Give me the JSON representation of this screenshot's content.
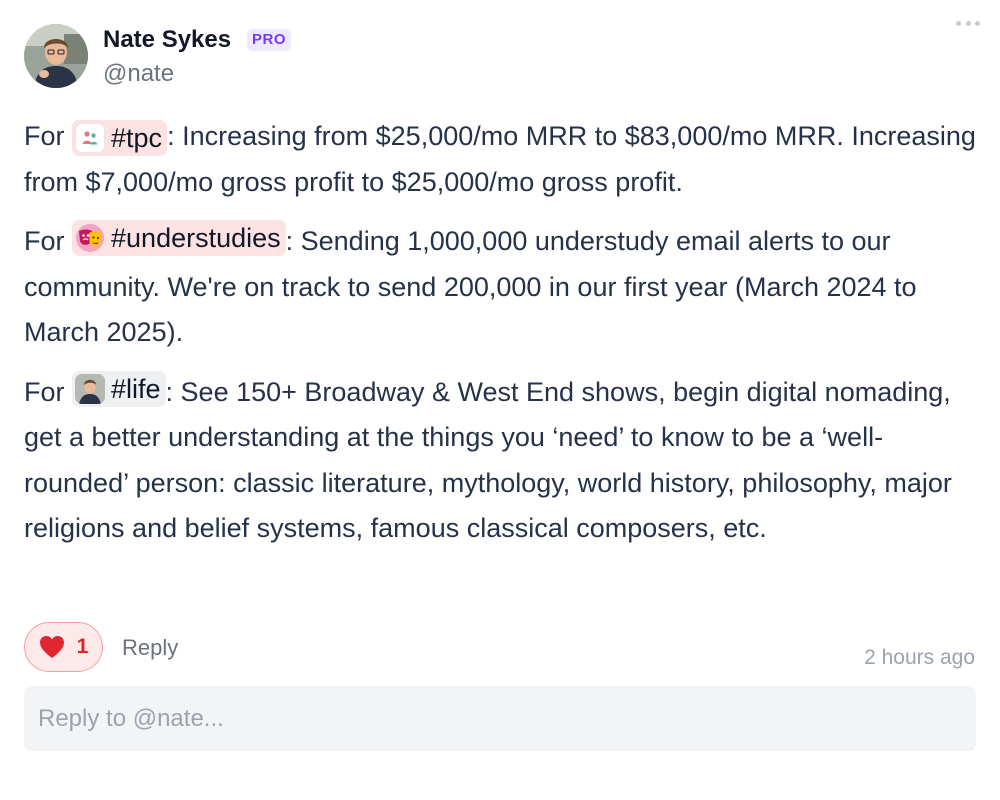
{
  "author": {
    "name": "Nate Sykes",
    "badge": "PRO",
    "handle": "@nate"
  },
  "post": {
    "paragraphs": [
      {
        "prefix": "For ",
        "tag": "#tpc",
        "tag_icon": "people-icon",
        "text": ": Increasing from $25,000/mo MRR to $83,000/mo MRR. Increasing from $7,000/mo gross profit to $25,000/mo gross profit."
      },
      {
        "prefix": "For ",
        "tag": "#understudies",
        "tag_icon": "theater-masks-icon",
        "text": ": Sending 1,000,000 understudy email alerts to our community. We're on track to send 200,000 in our first year (March 2024 to March 2025)."
      },
      {
        "prefix": "For ",
        "tag": "#life",
        "tag_icon": "avatar-photo-icon",
        "text": ": See 150+ Broadway & West End shows, begin digital nomading, get a better understanding at the things you ‘need’ to know to be a ‘well-rounded’ person: classic literature, mythology, world history, philosophy, major religions and belief systems, famous classical composers, etc."
      }
    ]
  },
  "actions": {
    "like_count": "1",
    "reply_label": "Reply",
    "timestamp": "2 hours ago"
  },
  "reply_box": {
    "placeholder": "Reply to @nate..."
  },
  "colors": {
    "accent_purple": "#7c3aed",
    "like_red": "#dc2626",
    "tag_bg": "#fde2e4"
  }
}
